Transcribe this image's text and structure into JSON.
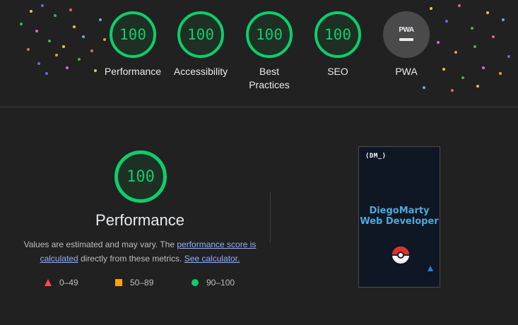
{
  "summary": {
    "gauges": [
      {
        "score": "100",
        "label": "Performance"
      },
      {
        "score": "100",
        "label": "Accessibility"
      },
      {
        "score": "100",
        "label": "Best Practices"
      },
      {
        "score": "100",
        "label": "SEO"
      },
      {
        "badge": "PWA",
        "label": "PWA"
      }
    ]
  },
  "performance": {
    "score": "100",
    "title": "Performance",
    "desc_prefix": "Values are estimated and may vary. The ",
    "link_score": "performance score is calculated",
    "desc_mid": " directly from these metrics. ",
    "link_calc": "See calculator.",
    "legend": [
      {
        "range": "0–49",
        "shape": "triangle",
        "color": "#ff4e42"
      },
      {
        "range": "50–89",
        "shape": "square",
        "color": "#ffa400"
      },
      {
        "range": "90–100",
        "shape": "circle",
        "color": "#0cce6b"
      }
    ]
  },
  "screenshot": {
    "logo_text": "⟨DM_⟩",
    "heading": "DiegoMarty Web Developer"
  },
  "colors": {
    "background": "#212121",
    "pass": "#0cce6b",
    "average": "#ffa400",
    "fail": "#ff4e42",
    "link": "#8ab4f8"
  }
}
